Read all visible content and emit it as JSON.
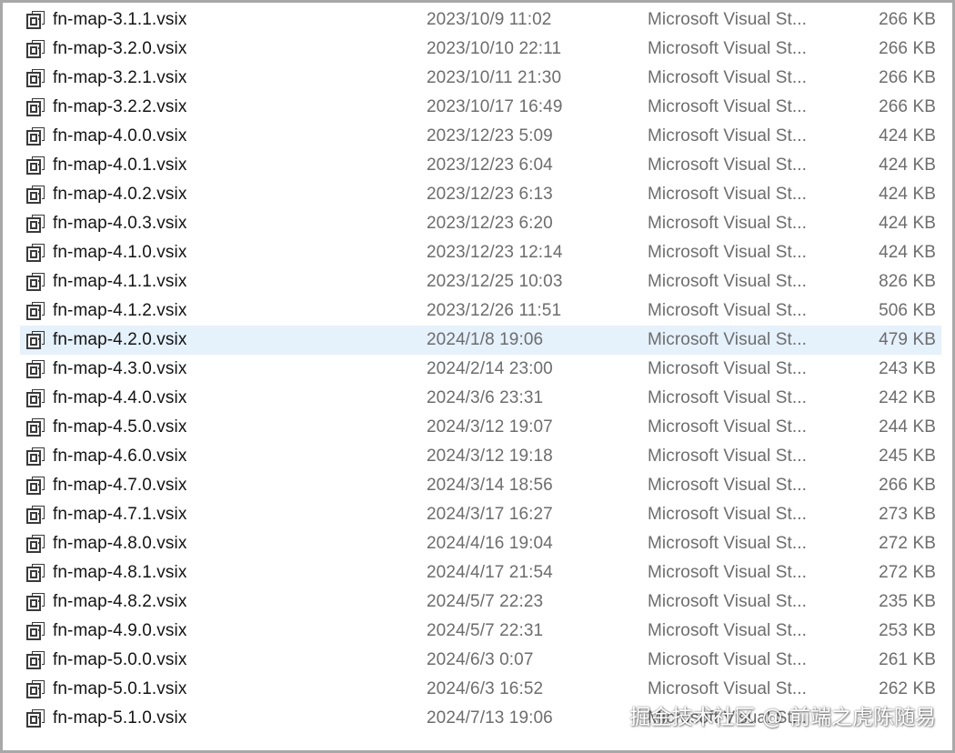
{
  "file_list": {
    "icon": "vsix-package-icon",
    "selected_index": 11,
    "rows": [
      {
        "name": "fn-map-3.1.1.vsix",
        "date": "2023/10/9 11:02",
        "type": "Microsoft Visual St...",
        "size": "266 KB"
      },
      {
        "name": "fn-map-3.2.0.vsix",
        "date": "2023/10/10 22:11",
        "type": "Microsoft Visual St...",
        "size": "266 KB"
      },
      {
        "name": "fn-map-3.2.1.vsix",
        "date": "2023/10/11 21:30",
        "type": "Microsoft Visual St...",
        "size": "266 KB"
      },
      {
        "name": "fn-map-3.2.2.vsix",
        "date": "2023/10/17 16:49",
        "type": "Microsoft Visual St...",
        "size": "266 KB"
      },
      {
        "name": "fn-map-4.0.0.vsix",
        "date": "2023/12/23 5:09",
        "type": "Microsoft Visual St...",
        "size": "424 KB"
      },
      {
        "name": "fn-map-4.0.1.vsix",
        "date": "2023/12/23 6:04",
        "type": "Microsoft Visual St...",
        "size": "424 KB"
      },
      {
        "name": "fn-map-4.0.2.vsix",
        "date": "2023/12/23 6:13",
        "type": "Microsoft Visual St...",
        "size": "424 KB"
      },
      {
        "name": "fn-map-4.0.3.vsix",
        "date": "2023/12/23 6:20",
        "type": "Microsoft Visual St...",
        "size": "424 KB"
      },
      {
        "name": "fn-map-4.1.0.vsix",
        "date": "2023/12/23 12:14",
        "type": "Microsoft Visual St...",
        "size": "424 KB"
      },
      {
        "name": "fn-map-4.1.1.vsix",
        "date": "2023/12/25 10:03",
        "type": "Microsoft Visual St...",
        "size": "826 KB"
      },
      {
        "name": "fn-map-4.1.2.vsix",
        "date": "2023/12/26 11:51",
        "type": "Microsoft Visual St...",
        "size": "506 KB"
      },
      {
        "name": "fn-map-4.2.0.vsix",
        "date": "2024/1/8 19:06",
        "type": "Microsoft Visual St...",
        "size": "479 KB"
      },
      {
        "name": "fn-map-4.3.0.vsix",
        "date": "2024/2/14 23:00",
        "type": "Microsoft Visual St...",
        "size": "243 KB"
      },
      {
        "name": "fn-map-4.4.0.vsix",
        "date": "2024/3/6 23:31",
        "type": "Microsoft Visual St...",
        "size": "242 KB"
      },
      {
        "name": "fn-map-4.5.0.vsix",
        "date": "2024/3/12 19:07",
        "type": "Microsoft Visual St...",
        "size": "244 KB"
      },
      {
        "name": "fn-map-4.6.0.vsix",
        "date": "2024/3/12 19:18",
        "type": "Microsoft Visual St...",
        "size": "245 KB"
      },
      {
        "name": "fn-map-4.7.0.vsix",
        "date": "2024/3/14 18:56",
        "type": "Microsoft Visual St...",
        "size": "266 KB"
      },
      {
        "name": "fn-map-4.7.1.vsix",
        "date": "2024/3/17 16:27",
        "type": "Microsoft Visual St...",
        "size": "273 KB"
      },
      {
        "name": "fn-map-4.8.0.vsix",
        "date": "2024/4/16 19:04",
        "type": "Microsoft Visual St...",
        "size": "272 KB"
      },
      {
        "name": "fn-map-4.8.1.vsix",
        "date": "2024/4/17 21:54",
        "type": "Microsoft Visual St...",
        "size": "272 KB"
      },
      {
        "name": "fn-map-4.8.2.vsix",
        "date": "2024/5/7 22:23",
        "type": "Microsoft Visual St...",
        "size": "235 KB"
      },
      {
        "name": "fn-map-4.9.0.vsix",
        "date": "2024/5/7 22:31",
        "type": "Microsoft Visual St...",
        "size": "253 KB"
      },
      {
        "name": "fn-map-5.0.0.vsix",
        "date": "2024/6/3 0:07",
        "type": "Microsoft Visual St...",
        "size": "261 KB"
      },
      {
        "name": "fn-map-5.0.1.vsix",
        "date": "2024/6/3 16:52",
        "type": "Microsoft Visual St...",
        "size": "262 KB"
      },
      {
        "name": "fn-map-5.1.0.vsix",
        "date": "2024/7/13 19:06",
        "type": "Microsoft Visual St...",
        "size": ""
      }
    ]
  },
  "watermark": {
    "text": "掘金技术社区 @ 前端之虎陈随易"
  },
  "colors": {
    "selection": "#e5f1fb",
    "name_text": "#141414",
    "secondary_text": "#6d6d6d"
  }
}
